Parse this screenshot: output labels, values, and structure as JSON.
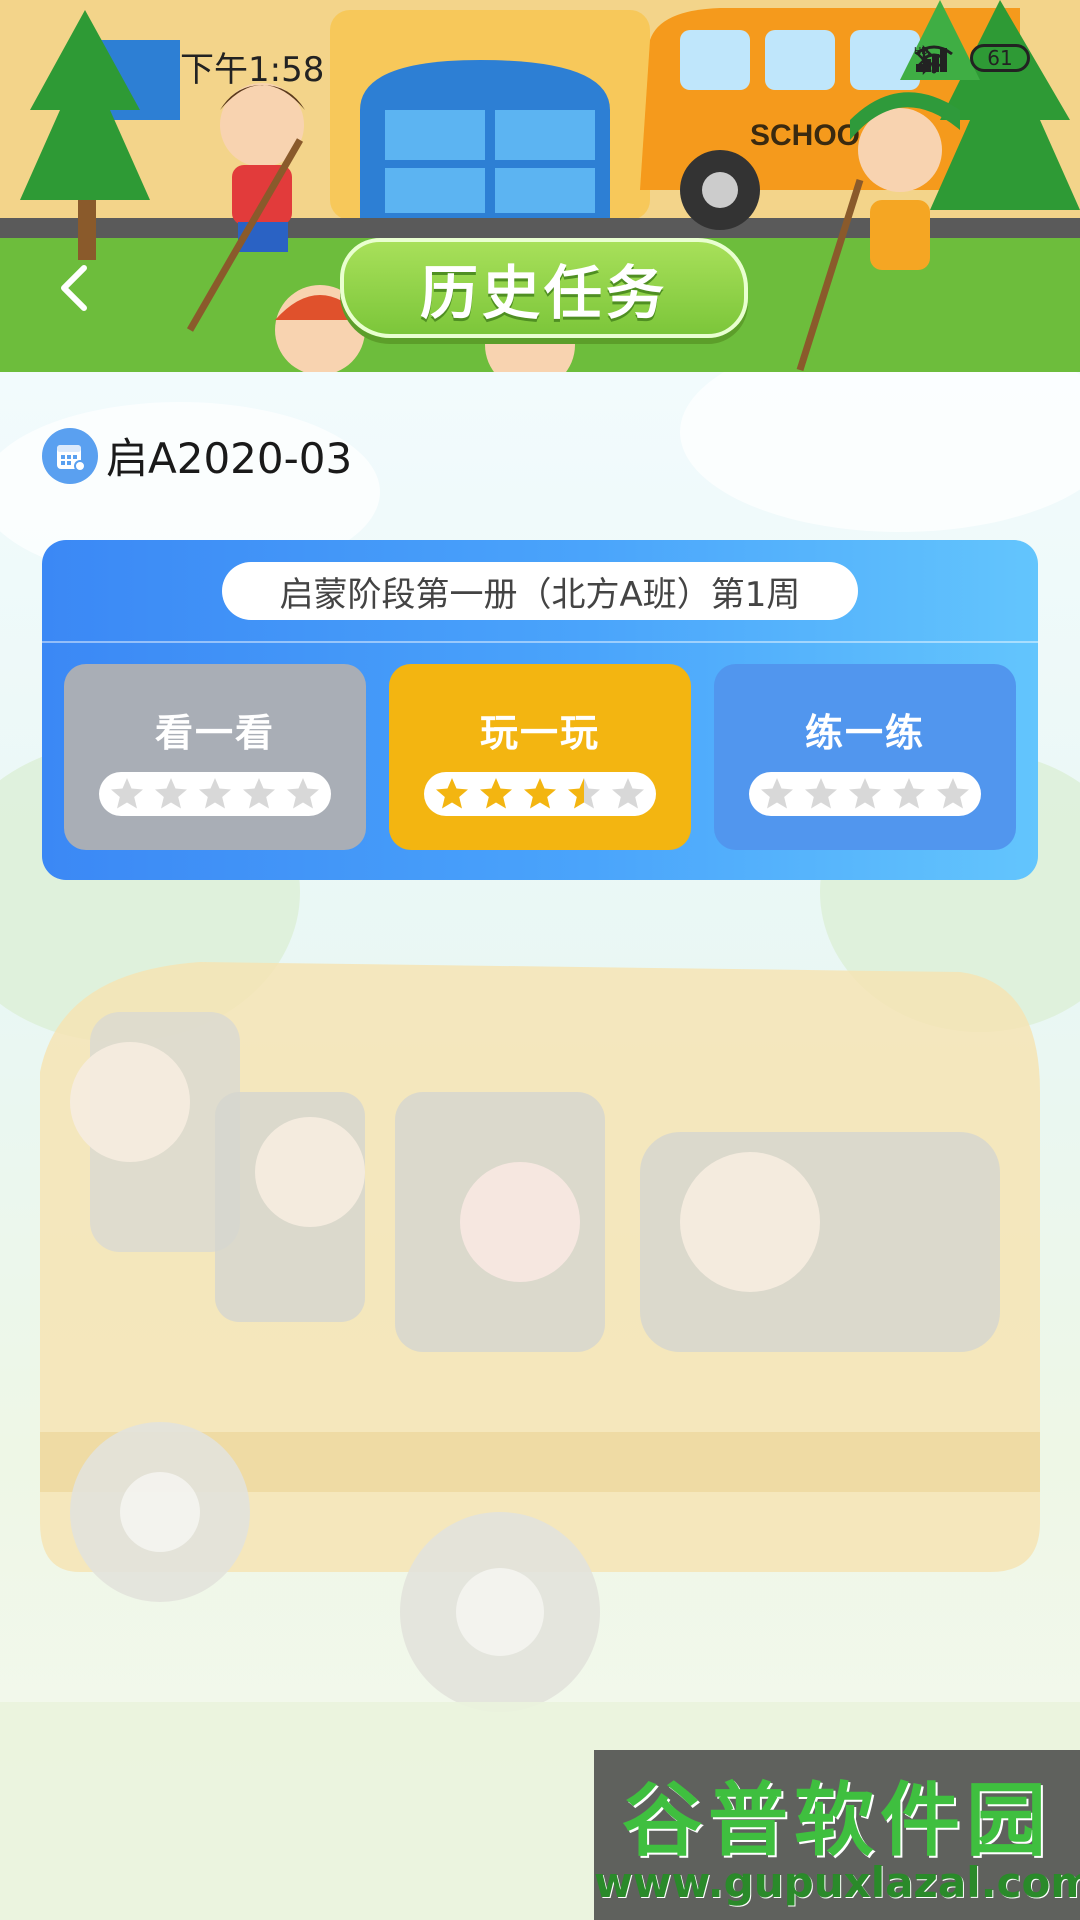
{
  "status_bar": {
    "time": "下午1:58",
    "battery": "61",
    "icons": [
      "bluetooth-icon",
      "hd-icon",
      "signal-icon",
      "signal-icon",
      "wifi-icon",
      "battery-icon"
    ]
  },
  "header": {
    "title": "历史任务",
    "back_icon": "chevron-left-icon"
  },
  "class_info": {
    "name": "启A2020-03",
    "icon": "calendar-icon"
  },
  "task_card": {
    "week_label": "启蒙阶段第一册（北方A班）第1周",
    "activities": [
      {
        "label": "看一看",
        "rating": 0,
        "max": 5,
        "color": "#a9aeb6"
      },
      {
        "label": "玩一玩",
        "rating": 3.5,
        "max": 5,
        "color": "#f3b511"
      },
      {
        "label": "练一练",
        "rating": 0,
        "max": 5,
        "color": "#5196ee"
      }
    ]
  },
  "colors": {
    "card_gradient_start": "#3b88f5",
    "card_gradient_end": "#63c5fd",
    "star_filled": "#f3b511",
    "star_empty": "#d8d8d8"
  },
  "watermark": {
    "line1": "谷普软件园",
    "line2": "www.gupuxlazal.com"
  }
}
